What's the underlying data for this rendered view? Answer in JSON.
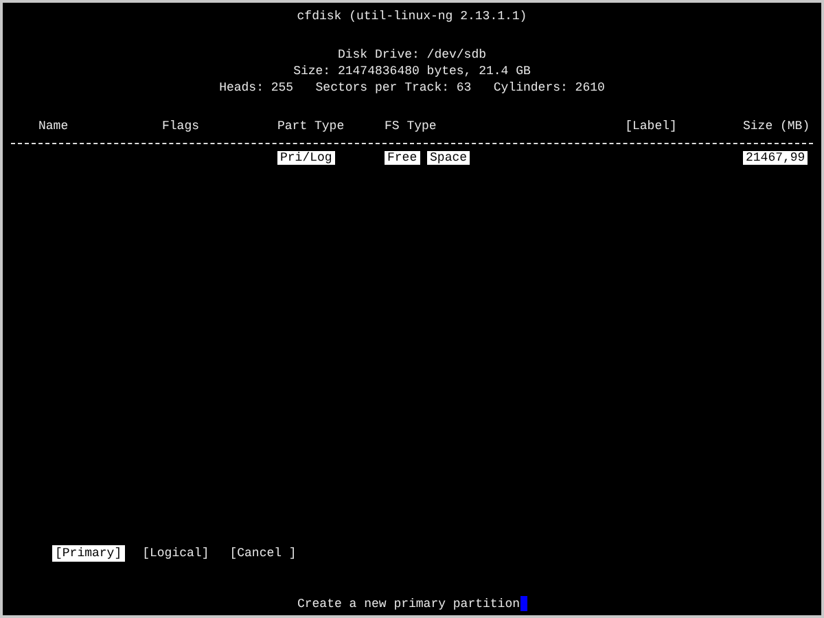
{
  "title": "cfdisk (util-linux-ng 2.13.1.1)",
  "disk_info": [
    "Disk Drive: /dev/sdb",
    "Size: 21474836480 bytes, 21.4 GB",
    "Heads: 255   Sectors per Track: 63   Cylinders: 2610"
  ],
  "table": {
    "columns": [
      "Name",
      "Flags",
      "Part Type",
      "FS Type",
      "[Label]",
      "Size (MB)"
    ],
    "rows": [
      {
        "selected": true,
        "part_type": "Pri/Log",
        "fs_type": [
          "Free",
          "Space"
        ],
        "size": "21467,99"
      }
    ]
  },
  "buttons": [
    {
      "label": "[Primary]",
      "selected": true
    },
    {
      "label": "[Logical]",
      "selected": false
    },
    {
      "label": "[Cancel ]",
      "selected": false
    }
  ],
  "status": "Create a new primary partition"
}
